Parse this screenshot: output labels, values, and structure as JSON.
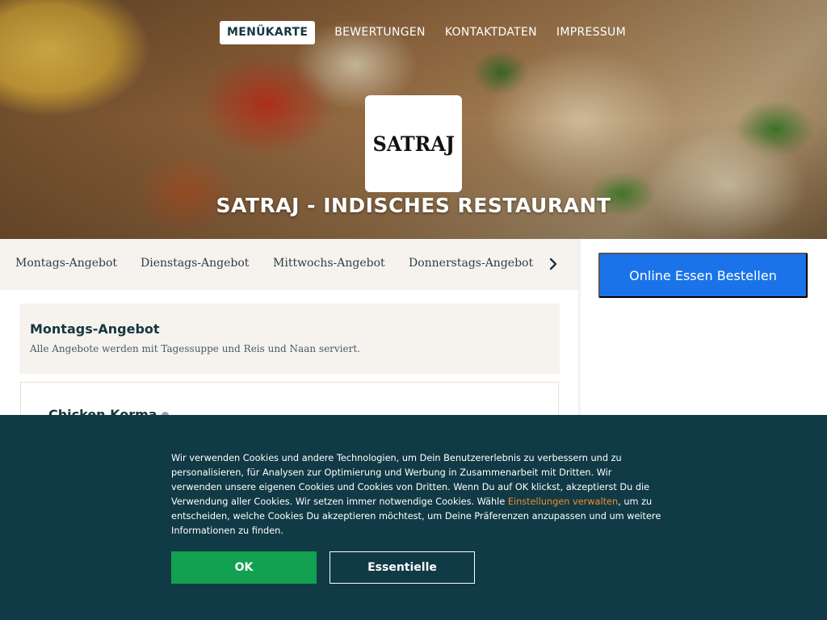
{
  "nav": {
    "items": [
      {
        "label": "MENÜKARTE",
        "active": true
      },
      {
        "label": "BEWERTUNGEN",
        "active": false
      },
      {
        "label": "KONTAKTDATEN",
        "active": false
      },
      {
        "label": "IMPRESSUM",
        "active": false
      }
    ]
  },
  "brand": {
    "logo_text": "SATRAJ",
    "title": "SATRAJ - INDISCHES RESTAURANT"
  },
  "tabs": [
    {
      "label": "Montags-Angebot"
    },
    {
      "label": "Dienstags-Angebot"
    },
    {
      "label": "Mittwochs-Angebot"
    },
    {
      "label": "Donnerstags-Angebot"
    }
  ],
  "tabs_scroll_icon": "chevron-right-icon",
  "section": {
    "title": "Montags-Angebot",
    "description": "Alle Angebote werden mit Tagessuppe und Reis und Naan serviert."
  },
  "dish": {
    "name": "Chicken Korma",
    "icon": "info-icon"
  },
  "sidebar": {
    "order_button": "Online Essen Bestellen"
  },
  "cookie": {
    "text_before": "Wir verwenden Cookies und andere Technologien, um Dein Benutzererlebnis zu verbessern und zu personalisieren, für Analysen zur Optimierung und Werbung in Zusammenarbeit mit Dritten. Wir verwenden unsere eigenen Cookies und Cookies von Dritten. Wenn Du auf OK klickst, akzeptierst Du die Verwendung aller Cookies. Wir setzen immer notwendige Cookies. Wähle ",
    "link": "Einstellungen verwalten",
    "text_after": ", um zu entscheiden, welche Cookies Du akzeptieren möchtest, um Deine Präferenzen anzupassen und um weitere Informationen zu finden.",
    "ok_button": "OK",
    "essential_button": "Essentielle"
  },
  "colors": {
    "primary_dark": "#103a45",
    "order_blue": "#1a73e8",
    "ok_green": "#12a150",
    "link_orange": "#f28c28",
    "tabs_bg": "#f6f3ef"
  }
}
